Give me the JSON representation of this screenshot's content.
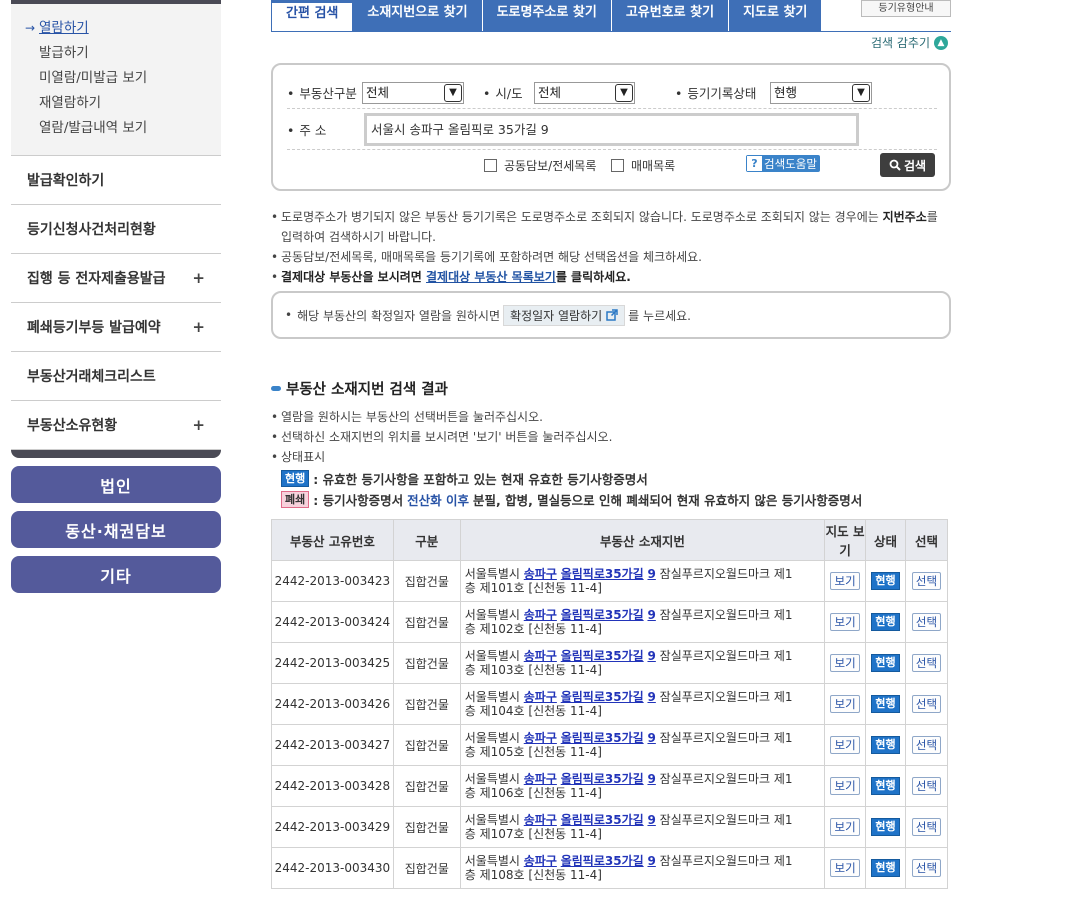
{
  "sidebar": {
    "sub_items": [
      {
        "label": "열람하기",
        "active": true
      },
      {
        "label": "발급하기"
      },
      {
        "label": "미열람/미발급 보기"
      },
      {
        "label": "재열람하기"
      },
      {
        "label": "열람/발급내역 보기"
      }
    ],
    "menu_items": [
      {
        "label": "발급확인하기",
        "plus": ""
      },
      {
        "label": "등기신청사건처리현황",
        "plus": ""
      },
      {
        "label": "집행 등 전자제출용발급",
        "plus": "+"
      },
      {
        "label": "폐쇄등기부등 발급예약",
        "plus": "+"
      },
      {
        "label": "부동산거래체크리스트",
        "plus": ""
      },
      {
        "label": "부동산소유현황",
        "plus": "+"
      }
    ],
    "buttons": [
      "법인",
      "동산·채권담보",
      "기타"
    ]
  },
  "tabs": [
    {
      "label": "간편 검색",
      "active": true
    },
    {
      "label": "소재지번으로 찾기"
    },
    {
      "label": "도로명주소로 찾기"
    },
    {
      "label": "고유번호로 찾기"
    },
    {
      "label": "지도로 찾기"
    }
  ],
  "guide_button": "등기유형안내",
  "collapse_link": "검색 감추기",
  "search": {
    "property_type_label": "부동산구분",
    "property_type_value": "전체",
    "region_label": "시/도",
    "region_value": "전체",
    "record_status_label": "등기기록상태",
    "record_status_value": "현행",
    "address_label": "주 소",
    "address_value": "서울시 송파구 올림픽로 35가길 9",
    "check_collateral": "공동담보/전세목록",
    "check_sale": "매매목록",
    "help_button": "검색도움말",
    "search_button": "검색"
  },
  "notes": {
    "n1_a": "도로명주소가 병기되지 않은 부동산 등기기록은 도로명주소로 조회되지 않습니다. 도로명주소로 조회되지 않는 경우에는 ",
    "n1_bold": "지번주소",
    "n1_b": "를",
    "n1_c": "입력하여 검색하시기 바랍니다.",
    "n2": "공동담보/전세목록, 매매목록을 등기기록에 포함하려면 해당 선택옵션을 체크하세요.",
    "n3_a": "결제대상 부동산을 보시려면 ",
    "n3_link": "결제대상 부동산 목록보기",
    "n3_b": "를 클릭하세요."
  },
  "confirm": {
    "before": "해당 부동산의 확정일자 열람을 원하시면",
    "chip": "확정일자 열람하기",
    "after": "를 누르세요."
  },
  "result": {
    "title": "부동산 소재지번 검색 결과",
    "note1": "열람을 원하시는 부동산의 선택버튼을 눌러주십시오.",
    "note2": "선택하신 소재지번의 위치를 보시려면 '보기' 버튼을 눌러주십시오.",
    "note3": "상태표시",
    "legend_current_badge": "현행",
    "legend_current_text": ": 유효한 등기사항을 포함하고 있는 현재 유효한 등기사항증명서",
    "legend_closed_badge": "폐쇄",
    "legend_closed_a": ": 등기사항증명서 ",
    "legend_closed_em": "전산화 이후",
    "legend_closed_b": " 분필, 합병, 멸실등으로 인해 폐쇄되어 현재 유효하지 않은 등기사항증명서"
  },
  "table": {
    "headers": [
      "부동산 고유번호",
      "구분",
      "부동산 소재지번",
      "지도 보기",
      "상태",
      "선택"
    ],
    "rows": [
      {
        "id": "2442-2013-003423",
        "type": "집합건물",
        "pre": "서울특별시 ",
        "gu": "송파구",
        "road": "올림픽로35가길",
        "num": "9",
        "rest1": " 잠실푸르지오월드마크 제1",
        "rest2": "층 제101호 [신천동 11-4]",
        "map": "보기",
        "state": "현행",
        "select": "선택"
      },
      {
        "id": "2442-2013-003424",
        "type": "집합건물",
        "pre": "서울특별시 ",
        "gu": "송파구",
        "road": "올림픽로35가길",
        "num": "9",
        "rest1": " 잠실푸르지오월드마크 제1",
        "rest2": "층 제102호 [신천동 11-4]",
        "map": "보기",
        "state": "현행",
        "select": "선택"
      },
      {
        "id": "2442-2013-003425",
        "type": "집합건물",
        "pre": "서울특별시 ",
        "gu": "송파구",
        "road": "올림픽로35가길",
        "num": "9",
        "rest1": " 잠실푸르지오월드마크 제1",
        "rest2": "층 제103호 [신천동 11-4]",
        "map": "보기",
        "state": "현행",
        "select": "선택"
      },
      {
        "id": "2442-2013-003426",
        "type": "집합건물",
        "pre": "서울특별시 ",
        "gu": "송파구",
        "road": "올림픽로35가길",
        "num": "9",
        "rest1": " 잠실푸르지오월드마크 제1",
        "rest2": "층 제104호 [신천동 11-4]",
        "map": "보기",
        "state": "현행",
        "select": "선택"
      },
      {
        "id": "2442-2013-003427",
        "type": "집합건물",
        "pre": "서울특별시 ",
        "gu": "송파구",
        "road": "올림픽로35가길",
        "num": "9",
        "rest1": " 잠실푸르지오월드마크 제1",
        "rest2": "층 제105호 [신천동 11-4]",
        "map": "보기",
        "state": "현행",
        "select": "선택"
      },
      {
        "id": "2442-2013-003428",
        "type": "집합건물",
        "pre": "서울특별시 ",
        "gu": "송파구",
        "road": "올림픽로35가길",
        "num": "9",
        "rest1": " 잠실푸르지오월드마크 제1",
        "rest2": "층 제106호 [신천동 11-4]",
        "map": "보기",
        "state": "현행",
        "select": "선택"
      },
      {
        "id": "2442-2013-003429",
        "type": "집합건물",
        "pre": "서울특별시 ",
        "gu": "송파구",
        "road": "올림픽로35가길",
        "num": "9",
        "rest1": " 잠실푸르지오월드마크 제1",
        "rest2": "층 제107호 [신천동 11-4]",
        "map": "보기",
        "state": "현행",
        "select": "선택"
      },
      {
        "id": "2442-2013-003430",
        "type": "집합건물",
        "pre": "서울특별시 ",
        "gu": "송파구",
        "road": "올림픽로35가길",
        "num": "9",
        "rest1": " 잠실푸르지오월드마크 제1",
        "rest2": "층 제108호 [신천동 11-4]",
        "map": "보기",
        "state": "현행",
        "select": "선택"
      }
    ]
  },
  "colors": {
    "tab_blue": "#3e6fb7",
    "side_button": "#545a9b",
    "badge_current": "#1f73c8",
    "badge_closed": "#f7d2dc"
  }
}
